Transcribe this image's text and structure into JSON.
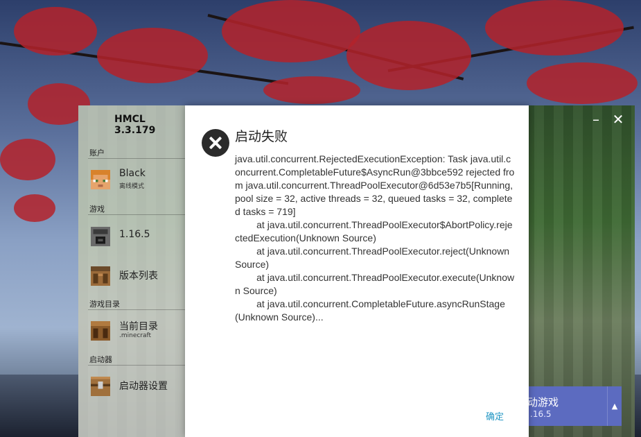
{
  "app": {
    "title": "HMCL 3.3.179"
  },
  "window_controls": {
    "minimize": "–",
    "close": "✕"
  },
  "sidebar": {
    "sections": {
      "account": "账户",
      "game": "游戏",
      "game_dir": "游戏目录",
      "launcher": "启动器"
    },
    "account": {
      "name": "Black",
      "mode": "离线模式"
    },
    "game_items": [
      {
        "label": "1.16.5"
      },
      {
        "label": "版本列表"
      }
    ],
    "dir_item": {
      "label": "当前目录",
      "sub": ".minecraft"
    },
    "launcher_item": {
      "label": "启动器设置"
    }
  },
  "launch_button": {
    "title": "动游戏",
    "version": ".16.5",
    "arrow": "▲"
  },
  "dialog": {
    "title": "启动失败",
    "message": "java.util.concurrent.RejectedExecutionException: Task java.util.concurrent.CompletableFuture$AsyncRun@3bbce592 rejected from java.util.concurrent.ThreadPoolExecutor@6d53e7b5[Running, pool size = 32, active threads = 32, queued tasks = 32, completed tasks = 719]\n        at java.util.concurrent.ThreadPoolExecutor$AbortPolicy.rejectedExecution(Unknown Source)\n        at java.util.concurrent.ThreadPoolExecutor.reject(Unknown Source)\n        at java.util.concurrent.ThreadPoolExecutor.execute(Unknown Source)\n        at java.util.concurrent.CompletableFuture.asyncRunStage(Unknown Source)...",
    "confirm_label": "确定"
  },
  "colors": {
    "accent": "#5c6bc0",
    "link": "#2196c3",
    "error_icon": "#2b2b2b"
  },
  "icons": [
    "error-icon",
    "steve-avatar-icon",
    "furnace-icon",
    "crafting-table-icon",
    "chest-icon"
  ]
}
